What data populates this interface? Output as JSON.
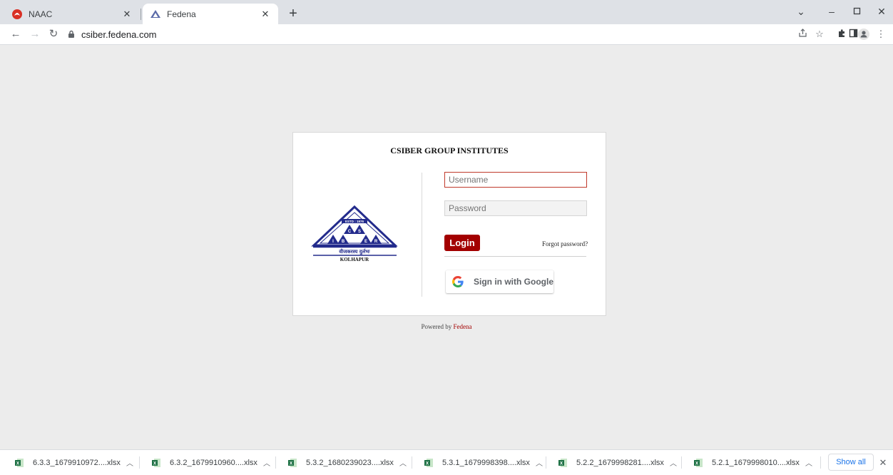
{
  "browser": {
    "tabs": [
      {
        "title": "NAAC",
        "favicon": "naac-logo-icon",
        "active": false
      },
      {
        "title": "Fedena",
        "favicon": "fedena-logo-icon",
        "active": true
      }
    ],
    "address": "csiber.fedena.com"
  },
  "login": {
    "institute_title": "CSIBER GROUP INSTITUTES",
    "logo": {
      "estd_text": "ESTD : 1976",
      "letters": [
        "C",
        "S",
        "I",
        "B",
        "E",
        "R"
      ],
      "tagline": "वीजकरस्य दुर्लभः",
      "city": "KOLHAPUR"
    },
    "username_placeholder": "Username",
    "password_placeholder": "Password",
    "login_label": "Login",
    "forgot_label": "Forgot password?",
    "google_label": "Sign in with Google"
  },
  "footer": {
    "powered_prefix": "Powered by ",
    "powered_link": "Fedena"
  },
  "downloads": {
    "items": [
      {
        "name": "6.3.3_1679910972....xlsx"
      },
      {
        "name": "6.3.2_1679910960....xlsx"
      },
      {
        "name": "5.3.2_1680239023....xlsx"
      },
      {
        "name": "5.3.1_1679998398....xlsx"
      },
      {
        "name": "5.2.2_1679998281....xlsx"
      },
      {
        "name": "5.2.1_1679998010....xlsx"
      }
    ],
    "show_all_label": "Show all"
  },
  "colors": {
    "accent": "#a30000",
    "link_blue": "#1a73e8",
    "excel_green": "#1e7145",
    "logo_blue": "#232b8c"
  }
}
